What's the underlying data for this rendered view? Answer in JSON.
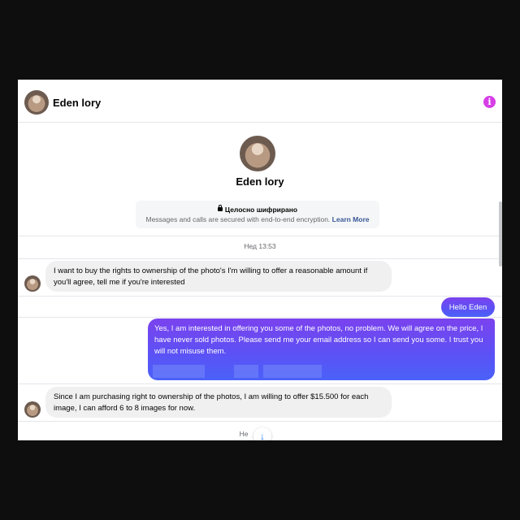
{
  "header": {
    "name": "Eden lory",
    "info_icon": "i"
  },
  "profile": {
    "name": "Eden lory"
  },
  "encryption": {
    "title": "Целосно шифрирано",
    "text": "Messages and calls are secured with end-to-end encryption.",
    "link": "Learn More"
  },
  "timestamp": "Нед 13:53",
  "messages": [
    {
      "direction": "in",
      "text": "I want to buy the rights to ownership of the photo's I'm willing to offer a reasonable amount if you'll agree, tell me if you're interested"
    },
    {
      "direction": "out",
      "text": "Hello Eden"
    },
    {
      "direction": "out",
      "text": "Yes, I am interested in offering you some of the photos, no problem. We will agree on the price, I have never sold photos. Please send me your email address so I can send you some. I trust you will not misuse them."
    },
    {
      "direction": "in",
      "text": "Since I am purchasing right to ownership of the photos, I am willing to offer $15.500 for each image, I can afford 6 to 8 images for now."
    }
  ],
  "footer_label": "Не",
  "scroll_icon": "↓",
  "colors": {
    "accent": "#d63ee6",
    "outgoing_top": "#7b42ee",
    "outgoing_bottom": "#4a62f8",
    "link": "#385898"
  }
}
